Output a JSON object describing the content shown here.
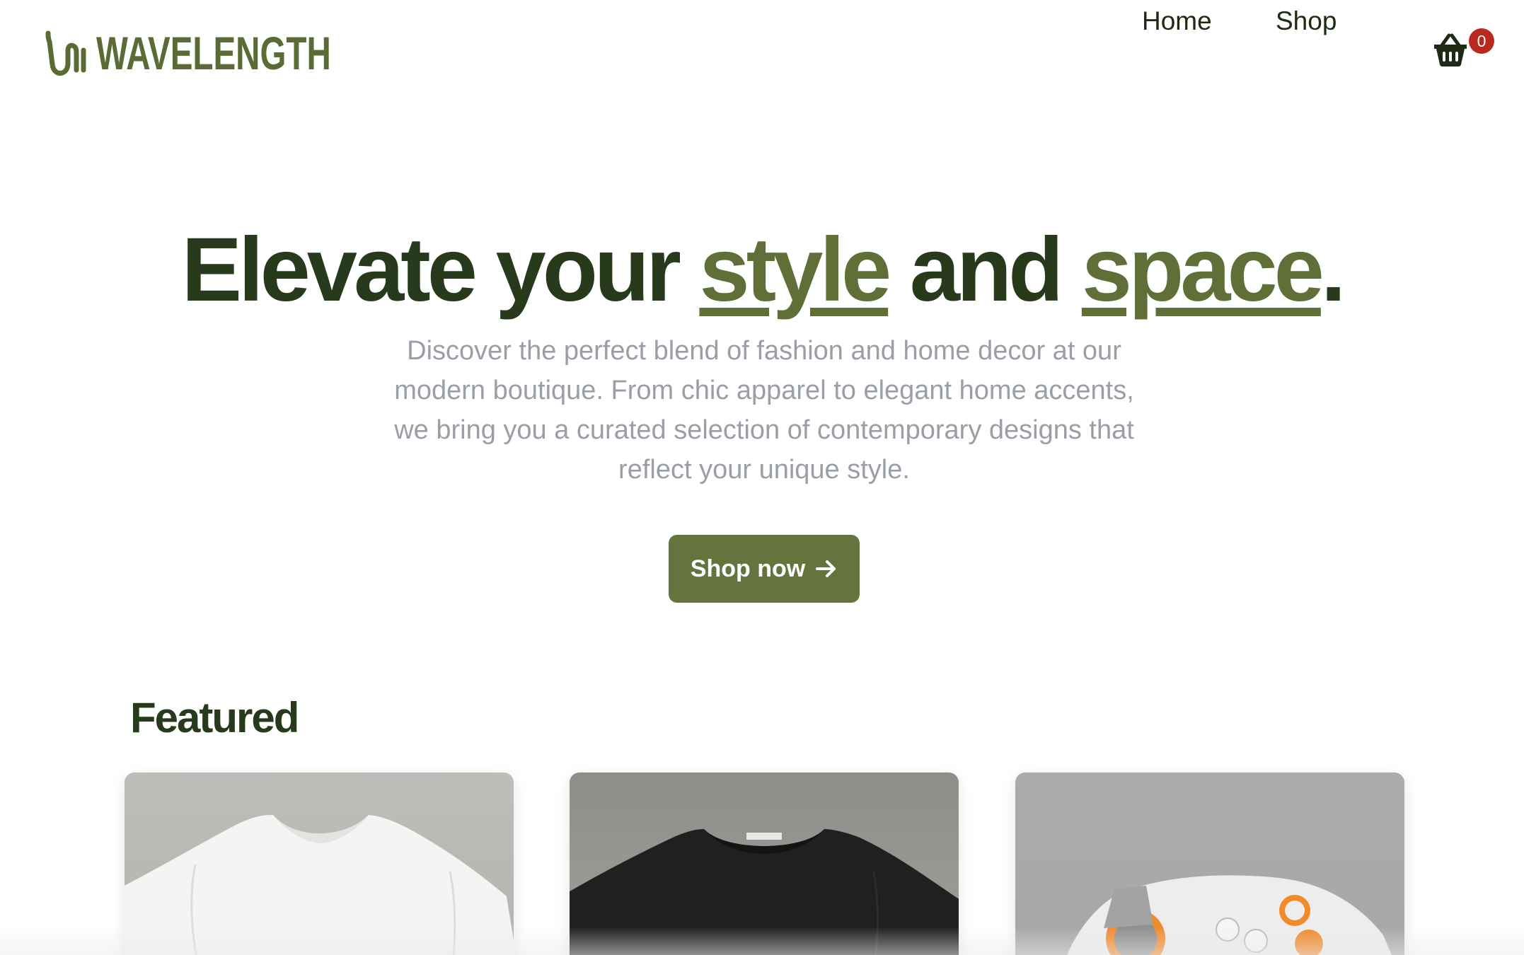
{
  "brand": {
    "name": "WAVELENGTH",
    "logo_icon": "wave-logo-icon",
    "color": "#5a6b36"
  },
  "nav": {
    "home_label": "Home",
    "shop_label": "Shop",
    "cart_icon": "basket-icon",
    "cart_count": "0"
  },
  "hero": {
    "title_part1": "Elevate your ",
    "title_accent1": "style",
    "title_part2": " and ",
    "title_accent2": "space",
    "title_part3": ".",
    "subtitle": "Discover the perfect blend of fashion and home decor at our modern boutique. From chic apparel to elegant home accents, we bring you a curated selection of contemporary designs that reflect your unique style.",
    "cta_label": "Shop now",
    "cta_icon": "arrow-right-icon"
  },
  "featured": {
    "heading": "Featured",
    "products": [
      {
        "image": "white-tshirt-image"
      },
      {
        "image": "black-tshirt-image"
      },
      {
        "image": "game-controller-image"
      }
    ]
  },
  "colors": {
    "heading": "#283a1c",
    "accent": "#5f6f37",
    "button": "#65733e",
    "badge": "#b8291f",
    "subtitle": "#9a9ea7"
  }
}
